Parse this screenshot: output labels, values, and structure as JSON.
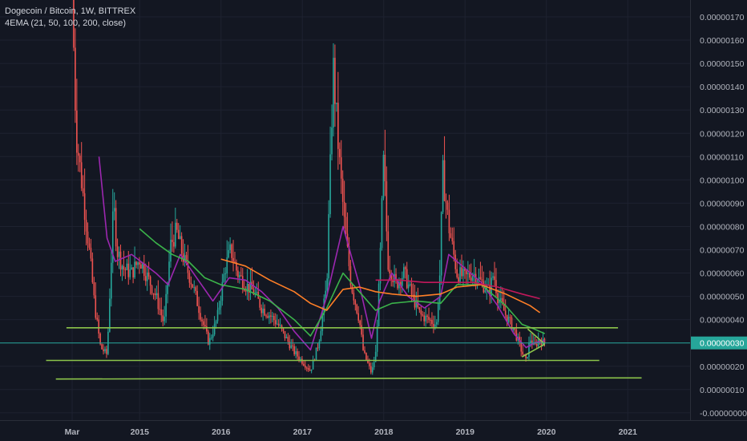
{
  "header": {
    "symbol_line": "Dogecoin / Bitcoin, 1W, BITTREX",
    "indicator_line": "4EMA (21, 50, 100, 200, close)"
  },
  "colors": {
    "background": "#131722",
    "grid": "#1e2230",
    "axis_text": "#b2b5be",
    "candle_up": "#26a69a",
    "candle_down": "#ef5350",
    "ema21": "#9c27b0",
    "ema50": "#3bb34a",
    "ema100": "#ff7f27",
    "ema200": "#c2185b",
    "support_line": "#8bc34a",
    "crosshair": "#26a69a",
    "price_label_bg": "#26a69a"
  },
  "price_axis": {
    "ticks": [
      "0.00000170",
      "0.00000160",
      "0.00000150",
      "0.00000140",
      "0.00000130",
      "0.00000120",
      "0.00000110",
      "0.00000100",
      "0.00000090",
      "0.00000080",
      "0.00000070",
      "0.00000060",
      "0.00000050",
      "0.00000040",
      "0.00000030",
      "0.00000020",
      "0.00000010",
      "-0.00000000"
    ],
    "current_price_label": "0.00000030"
  },
  "time_axis": {
    "labels": [
      "Mar",
      "2015",
      "2016",
      "2017",
      "2018",
      "2019",
      "2020",
      "2021"
    ]
  },
  "chart_data": {
    "type": "candlestick",
    "title": "Dogecoin / Bitcoin, 1W, BITTREX",
    "indicator": "4EMA (21, 50, 100, 200, close)",
    "ylim": [
      -1.5e-09,
      1.795e-07
    ],
    "x_ticks": [
      {
        "label": "Mar",
        "t": 2014.17
      },
      {
        "label": "2015",
        "t": 2015.0
      },
      {
        "label": "2016",
        "t": 2016.0
      },
      {
        "label": "2017",
        "t": 2017.0
      },
      {
        "label": "2018",
        "t": 2018.0
      },
      {
        "label": "2019",
        "t": 2019.0
      },
      {
        "label": "2020",
        "t": 2020.0
      },
      {
        "label": "2021",
        "t": 2021.0
      }
    ],
    "price_path": [
      [
        2014.17,
        180
      ],
      [
        2014.22,
        120
      ],
      [
        2014.3,
        95
      ],
      [
        2014.38,
        70
      ],
      [
        2014.45,
        45
      ],
      [
        2014.52,
        28
      ],
      [
        2014.6,
        25
      ],
      [
        2014.68,
        90
      ],
      [
        2014.72,
        70
      ],
      [
        2014.8,
        62
      ],
      [
        2014.9,
        60
      ],
      [
        2015.0,
        66
      ],
      [
        2015.1,
        58
      ],
      [
        2015.2,
        50
      ],
      [
        2015.3,
        38
      ],
      [
        2015.38,
        72
      ],
      [
        2015.45,
        78
      ],
      [
        2015.55,
        65
      ],
      [
        2015.65,
        55
      ],
      [
        2015.75,
        42
      ],
      [
        2015.85,
        30
      ],
      [
        2015.95,
        40
      ],
      [
        2016.05,
        62
      ],
      [
        2016.12,
        70
      ],
      [
        2016.2,
        60
      ],
      [
        2016.3,
        55
      ],
      [
        2016.4,
        52
      ],
      [
        2016.5,
        45
      ],
      [
        2016.6,
        42
      ],
      [
        2016.7,
        38
      ],
      [
        2016.8,
        32
      ],
      [
        2016.9,
        26
      ],
      [
        2017.0,
        22
      ],
      [
        2017.1,
        18
      ],
      [
        2017.2,
        30
      ],
      [
        2017.3,
        55
      ],
      [
        2017.38,
        148
      ],
      [
        2017.45,
        110
      ],
      [
        2017.52,
        80
      ],
      [
        2017.6,
        55
      ],
      [
        2017.7,
        40
      ],
      [
        2017.75,
        26
      ],
      [
        2017.85,
        17
      ],
      [
        2017.9,
        25
      ],
      [
        2017.95,
        60
      ],
      [
        2018.0,
        110
      ],
      [
        2018.05,
        65
      ],
      [
        2018.15,
        55
      ],
      [
        2018.25,
        60
      ],
      [
        2018.35,
        50
      ],
      [
        2018.45,
        42
      ],
      [
        2018.55,
        40
      ],
      [
        2018.65,
        38
      ],
      [
        2018.7,
        65
      ],
      [
        2018.72,
        105
      ],
      [
        2018.8,
        80
      ],
      [
        2018.9,
        60
      ],
      [
        2019.0,
        58
      ],
      [
        2019.1,
        60
      ],
      [
        2019.2,
        56
      ],
      [
        2019.3,
        52
      ],
      [
        2019.35,
        60
      ],
      [
        2019.4,
        50
      ],
      [
        2019.5,
        42
      ],
      [
        2019.6,
        36
      ],
      [
        2019.7,
        26
      ],
      [
        2019.75,
        22
      ],
      [
        2019.8,
        32
      ],
      [
        2019.85,
        28
      ],
      [
        2019.9,
        31
      ],
      [
        2019.98,
        30
      ]
    ],
    "ema_series": [
      {
        "name": "EMA 21",
        "color": "#9c27b0",
        "points": [
          [
            2014.5,
            110
          ],
          [
            2014.6,
            75
          ],
          [
            2014.7,
            65
          ],
          [
            2014.9,
            68
          ],
          [
            2015.2,
            60
          ],
          [
            2015.35,
            55
          ],
          [
            2015.5,
            68
          ],
          [
            2015.7,
            58
          ],
          [
            2015.9,
            48
          ],
          [
            2016.1,
            58
          ],
          [
            2016.3,
            57
          ],
          [
            2016.5,
            52
          ],
          [
            2016.7,
            45
          ],
          [
            2016.9,
            35
          ],
          [
            2017.1,
            27
          ],
          [
            2017.3,
            50
          ],
          [
            2017.5,
            80
          ],
          [
            2017.7,
            55
          ],
          [
            2017.85,
            32
          ],
          [
            2017.95,
            48
          ],
          [
            2018.1,
            60
          ],
          [
            2018.3,
            50
          ],
          [
            2018.5,
            45
          ],
          [
            2018.7,
            50
          ],
          [
            2018.8,
            68
          ],
          [
            2019.0,
            62
          ],
          [
            2019.2,
            56
          ],
          [
            2019.4,
            46
          ],
          [
            2019.6,
            34
          ],
          [
            2019.75,
            28
          ],
          [
            2019.85,
            30
          ],
          [
            2019.98,
            31
          ]
        ]
      },
      {
        "name": "EMA 50",
        "color": "#3bb34a",
        "points": [
          [
            2015.0,
            79
          ],
          [
            2015.2,
            73
          ],
          [
            2015.4,
            68
          ],
          [
            2015.6,
            65
          ],
          [
            2015.8,
            58
          ],
          [
            2016.0,
            55
          ],
          [
            2016.3,
            53
          ],
          [
            2016.6,
            48
          ],
          [
            2016.9,
            40
          ],
          [
            2017.1,
            33
          ],
          [
            2017.3,
            45
          ],
          [
            2017.5,
            60
          ],
          [
            2017.7,
            52
          ],
          [
            2017.9,
            44
          ],
          [
            2018.1,
            47
          ],
          [
            2018.4,
            48
          ],
          [
            2018.7,
            47
          ],
          [
            2018.9,
            55
          ],
          [
            2019.2,
            55
          ],
          [
            2019.5,
            46
          ],
          [
            2019.7,
            38
          ],
          [
            2019.85,
            36
          ],
          [
            2019.98,
            34
          ]
        ]
      },
      {
        "name": "EMA 100",
        "color": "#ff7f27",
        "points": [
          [
            2016.0,
            66
          ],
          [
            2016.3,
            63
          ],
          [
            2016.6,
            57
          ],
          [
            2016.9,
            52
          ],
          [
            2017.1,
            47
          ],
          [
            2017.3,
            44
          ],
          [
            2017.5,
            53
          ],
          [
            2017.7,
            54
          ],
          [
            2017.9,
            52
          ],
          [
            2018.1,
            51
          ],
          [
            2018.4,
            50
          ],
          [
            2018.7,
            51
          ],
          [
            2018.9,
            54
          ],
          [
            2019.2,
            55
          ],
          [
            2019.5,
            51
          ],
          [
            2019.8,
            46
          ],
          [
            2019.92,
            43
          ]
        ]
      },
      {
        "name": "EMA 200",
        "color": "#c2185b",
        "points": [
          [
            2017.9,
            57
          ],
          [
            2018.2,
            57
          ],
          [
            2018.5,
            56
          ],
          [
            2018.8,
            56
          ],
          [
            2019.1,
            56
          ],
          [
            2019.4,
            54
          ],
          [
            2019.7,
            51
          ],
          [
            2019.92,
            49
          ]
        ]
      }
    ],
    "support_lines": [
      {
        "t1": 2014.1,
        "v1": 36.5,
        "t2": 2020.88,
        "v2": 36.5
      },
      {
        "t1": 2013.85,
        "v1": 22.5,
        "t2": 2020.65,
        "v2": 22.5
      },
      {
        "t1": 2013.97,
        "v1": 14.5,
        "t2": 2021.17,
        "v2": 15
      },
      {
        "t1": 2019.7,
        "v1": 24,
        "t2": 2019.98,
        "v2": 29.5
      },
      {
        "t1": 2019.77,
        "v1": 36,
        "t2": 2019.98,
        "v2": 29.5
      }
    ],
    "current_price": 30,
    "value_unit_note": "values x 1e-8 BTC"
  }
}
